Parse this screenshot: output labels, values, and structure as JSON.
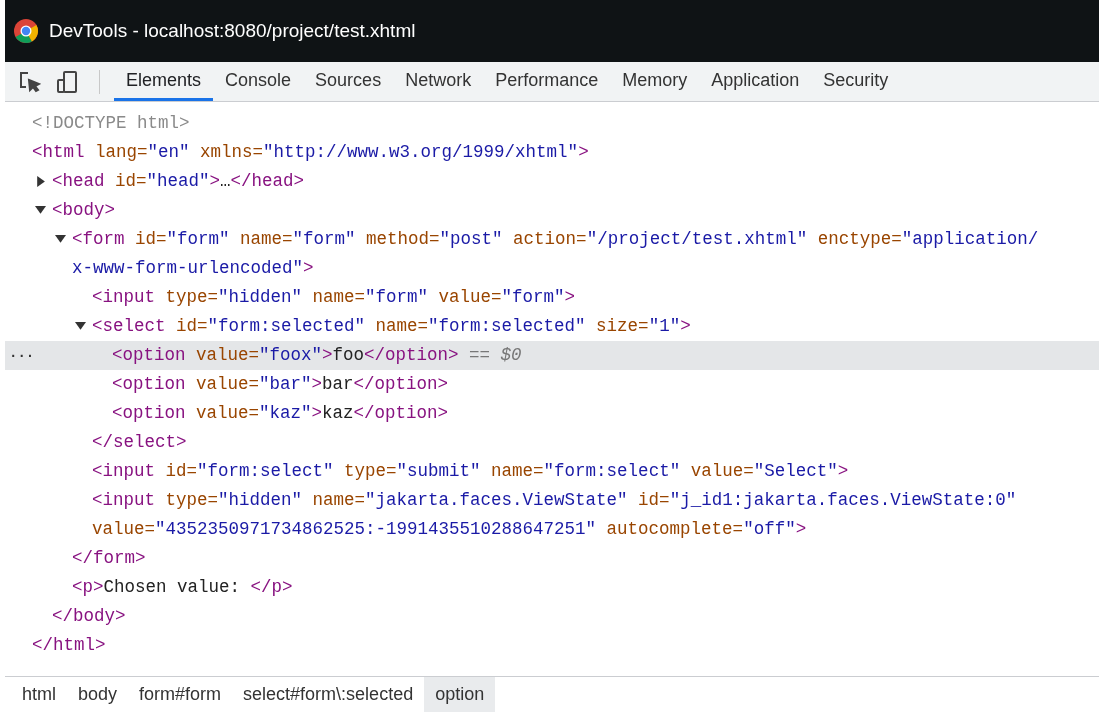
{
  "window": {
    "title": "DevTools - localhost:8080/project/test.xhtml"
  },
  "tabs": [
    {
      "label": "Elements",
      "selected": true
    },
    {
      "label": "Console",
      "selected": false
    },
    {
      "label": "Sources",
      "selected": false
    },
    {
      "label": "Network",
      "selected": false
    },
    {
      "label": "Performance",
      "selected": false
    },
    {
      "label": "Memory",
      "selected": false
    },
    {
      "label": "Application",
      "selected": false
    },
    {
      "label": "Security",
      "selected": false
    }
  ],
  "dom": [
    {
      "selected": false,
      "lines": [
        [
          {
            "kind": "doctype",
            "text": "<!DOCTYPE html>"
          }
        ]
      ]
    },
    {
      "selected": false,
      "lines": [
        [
          {
            "kind": "tag",
            "text": "<html"
          },
          {
            "kind": "attr",
            "text": " lang="
          },
          {
            "kind": "value",
            "text": "\"en\""
          },
          {
            "kind": "attr",
            "text": " xmlns="
          },
          {
            "kind": "value",
            "text": "\"http://www.w3.org/1999/xhtml\""
          },
          {
            "kind": "tag",
            "text": ">"
          }
        ]
      ],
      "close": [
        {
          "kind": "tag",
          "text": "</html>"
        }
      ],
      "children": [
        {
          "selected": false,
          "expanded": false,
          "lines": [
            [
              {
                "kind": "tag",
                "text": "<head"
              },
              {
                "kind": "attr",
                "text": " id="
              },
              {
                "kind": "value",
                "text": "\"head\""
              },
              {
                "kind": "tag",
                "text": ">"
              },
              {
                "kind": "content",
                "text": "…"
              },
              {
                "kind": "tag",
                "text": "</head>"
              }
            ]
          ]
        },
        {
          "selected": false,
          "expanded": true,
          "lines": [
            [
              {
                "kind": "tag",
                "text": "<body>"
              }
            ]
          ],
          "close": [
            {
              "kind": "tag",
              "text": "</body>"
            }
          ],
          "children": [
            {
              "selected": false,
              "expanded": true,
              "lines": [
                [
                  {
                    "kind": "tag",
                    "text": "<form"
                  },
                  {
                    "kind": "attr",
                    "text": " id="
                  },
                  {
                    "kind": "value",
                    "text": "\"form\""
                  },
                  {
                    "kind": "attr",
                    "text": " name="
                  },
                  {
                    "kind": "value",
                    "text": "\"form\""
                  },
                  {
                    "kind": "attr",
                    "text": " method="
                  },
                  {
                    "kind": "value",
                    "text": "\"post\""
                  },
                  {
                    "kind": "attr",
                    "text": " action="
                  },
                  {
                    "kind": "value",
                    "text": "\"/project/test.xhtml\""
                  },
                  {
                    "kind": "attr",
                    "text": " enctype="
                  },
                  {
                    "kind": "value",
                    "text": "\"application/"
                  }
                ],
                [
                  {
                    "kind": "value",
                    "text": "x-www-form-urlencoded\""
                  },
                  {
                    "kind": "tag",
                    "text": ">"
                  }
                ]
              ],
              "close": [
                {
                  "kind": "tag",
                  "text": "</form>"
                }
              ],
              "children": [
                {
                  "selected": false,
                  "lines": [
                    [
                      {
                        "kind": "tag",
                        "text": "<input"
                      },
                      {
                        "kind": "attr",
                        "text": " type="
                      },
                      {
                        "kind": "value",
                        "text": "\"hidden\""
                      },
                      {
                        "kind": "attr",
                        "text": " name="
                      },
                      {
                        "kind": "value",
                        "text": "\"form\""
                      },
                      {
                        "kind": "attr",
                        "text": " value="
                      },
                      {
                        "kind": "value",
                        "text": "\"form\""
                      },
                      {
                        "kind": "tag",
                        "text": ">"
                      }
                    ]
                  ]
                },
                {
                  "selected": false,
                  "expanded": true,
                  "lines": [
                    [
                      {
                        "kind": "tag",
                        "text": "<select"
                      },
                      {
                        "kind": "attr",
                        "text": " id="
                      },
                      {
                        "kind": "value",
                        "text": "\"form:selected\""
                      },
                      {
                        "kind": "attr",
                        "text": " name="
                      },
                      {
                        "kind": "value",
                        "text": "\"form:selected\""
                      },
                      {
                        "kind": "attr",
                        "text": " size="
                      },
                      {
                        "kind": "value",
                        "text": "\"1\""
                      },
                      {
                        "kind": "tag",
                        "text": ">"
                      }
                    ]
                  ],
                  "close": [
                    {
                      "kind": "tag",
                      "text": "</select>"
                    }
                  ],
                  "children": [
                    {
                      "selected": true,
                      "lines": [
                        [
                          {
                            "kind": "tag",
                            "text": "<option"
                          },
                          {
                            "kind": "attr",
                            "text": " value="
                          },
                          {
                            "kind": "value",
                            "text": "\"foox\""
                          },
                          {
                            "kind": "tag",
                            "text": ">"
                          },
                          {
                            "kind": "content",
                            "text": "foo"
                          },
                          {
                            "kind": "tag",
                            "text": "</option>"
                          },
                          {
                            "kind": "marker",
                            "text": " == $0"
                          }
                        ]
                      ]
                    },
                    {
                      "selected": false,
                      "lines": [
                        [
                          {
                            "kind": "tag",
                            "text": "<option"
                          },
                          {
                            "kind": "attr",
                            "text": " value="
                          },
                          {
                            "kind": "value",
                            "text": "\"bar\""
                          },
                          {
                            "kind": "tag",
                            "text": ">"
                          },
                          {
                            "kind": "content",
                            "text": "bar"
                          },
                          {
                            "kind": "tag",
                            "text": "</option>"
                          }
                        ]
                      ]
                    },
                    {
                      "selected": false,
                      "lines": [
                        [
                          {
                            "kind": "tag",
                            "text": "<option"
                          },
                          {
                            "kind": "attr",
                            "text": " value="
                          },
                          {
                            "kind": "value",
                            "text": "\"kaz\""
                          },
                          {
                            "kind": "tag",
                            "text": ">"
                          },
                          {
                            "kind": "content",
                            "text": "kaz"
                          },
                          {
                            "kind": "tag",
                            "text": "</option>"
                          }
                        ]
                      ]
                    }
                  ]
                },
                {
                  "selected": false,
                  "lines": [
                    [
                      {
                        "kind": "tag",
                        "text": "<input"
                      },
                      {
                        "kind": "attr",
                        "text": " id="
                      },
                      {
                        "kind": "value",
                        "text": "\"form:select\""
                      },
                      {
                        "kind": "attr",
                        "text": " type="
                      },
                      {
                        "kind": "value",
                        "text": "\"submit\""
                      },
                      {
                        "kind": "attr",
                        "text": " name="
                      },
                      {
                        "kind": "value",
                        "text": "\"form:select\""
                      },
                      {
                        "kind": "attr",
                        "text": " value="
                      },
                      {
                        "kind": "value",
                        "text": "\"Select\""
                      },
                      {
                        "kind": "tag",
                        "text": ">"
                      }
                    ]
                  ]
                },
                {
                  "selected": false,
                  "lines": [
                    [
                      {
                        "kind": "tag",
                        "text": "<input"
                      },
                      {
                        "kind": "attr",
                        "text": " type="
                      },
                      {
                        "kind": "value",
                        "text": "\"hidden\""
                      },
                      {
                        "kind": "attr",
                        "text": " name="
                      },
                      {
                        "kind": "value",
                        "text": "\"jakarta.faces.ViewState\""
                      },
                      {
                        "kind": "attr",
                        "text": " id="
                      },
                      {
                        "kind": "value",
                        "text": "\"j_id1:jakarta.faces.ViewState:0\""
                      }
                    ],
                    [
                      {
                        "kind": "attr",
                        "text": "value="
                      },
                      {
                        "kind": "value",
                        "text": "\"4352350971734862525:-1991435510288647251\""
                      },
                      {
                        "kind": "attr",
                        "text": " autocomplete="
                      },
                      {
                        "kind": "value",
                        "text": "\"off\""
                      },
                      {
                        "kind": "tag",
                        "text": ">"
                      }
                    ]
                  ]
                }
              ]
            },
            {
              "selected": false,
              "lines": [
                [
                  {
                    "kind": "tag",
                    "text": "<p>"
                  },
                  {
                    "kind": "content",
                    "text": "Chosen value: "
                  },
                  {
                    "kind": "tag",
                    "text": "</p>"
                  }
                ]
              ]
            }
          ]
        }
      ]
    }
  ],
  "selected_marker": "...",
  "breadcrumbs": [
    {
      "label": "html",
      "selected": false
    },
    {
      "label": "body",
      "selected": false
    },
    {
      "label": "form#form",
      "selected": false
    },
    {
      "label": "select#form\\:selected",
      "selected": false
    },
    {
      "label": "option",
      "selected": true
    }
  ]
}
